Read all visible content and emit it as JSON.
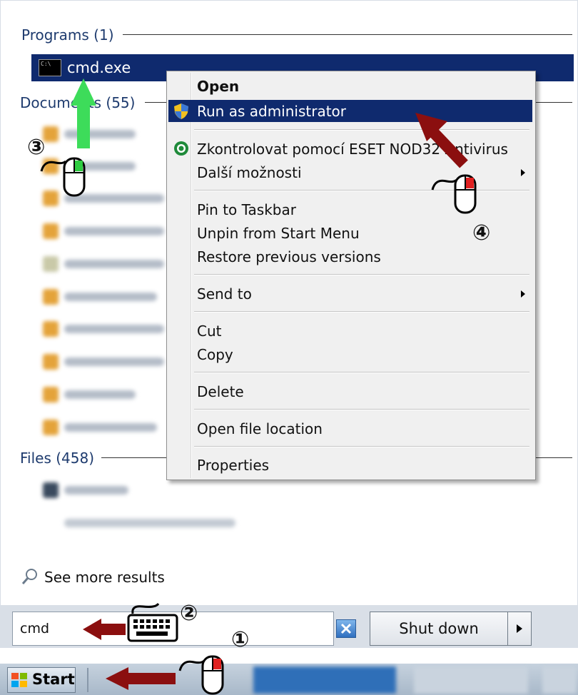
{
  "sections": {
    "programs": "Programs (1)",
    "documents": "Documents (55)",
    "files": "Files (458)"
  },
  "program_item": "cmd.exe",
  "cmd_icon_text": "C:\\",
  "see_more": "See more results",
  "search_value": "cmd",
  "shutdown_label": "Shut down",
  "start_label": "Start",
  "context_menu": {
    "open": "Open",
    "run_as_admin": "Run as administrator",
    "eset": "Zkontrolovat pomocí ESET NOD32 Antivirus",
    "more_options": "Další možnosti",
    "pin_taskbar": "Pin to Taskbar",
    "unpin_start": "Unpin from Start Menu",
    "restore_versions": "Restore previous versions",
    "send_to": "Send to",
    "cut": "Cut",
    "copy": "Copy",
    "delete": "Delete",
    "open_location": "Open file location",
    "properties": "Properties"
  },
  "step_markers": {
    "step1": "①",
    "step2": "②",
    "step3": "③",
    "step4": "④"
  },
  "colors": {
    "highlight": "#0f2a6e",
    "arrow_red": "#8b0f0f",
    "arrow_green": "#3ddc5a",
    "mouse_red": "#e02020",
    "mouse_green": "#2ecc40"
  }
}
